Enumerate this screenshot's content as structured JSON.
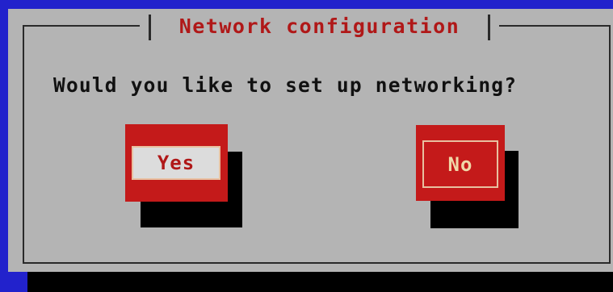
{
  "dialog": {
    "title": "Network configuration",
    "question": "Would you like to set up networking?"
  },
  "buttons": {
    "yes_label": "Yes",
    "no_label": "No",
    "focused": "Yes"
  },
  "colors": {
    "screen_background": "#2222cc",
    "dialog_background": "#b4b4b4",
    "title_text": "#b01818",
    "button_face": "#c41a1a",
    "button_focus_fill": "#dcdcdc",
    "button_shadow": "#000000"
  }
}
